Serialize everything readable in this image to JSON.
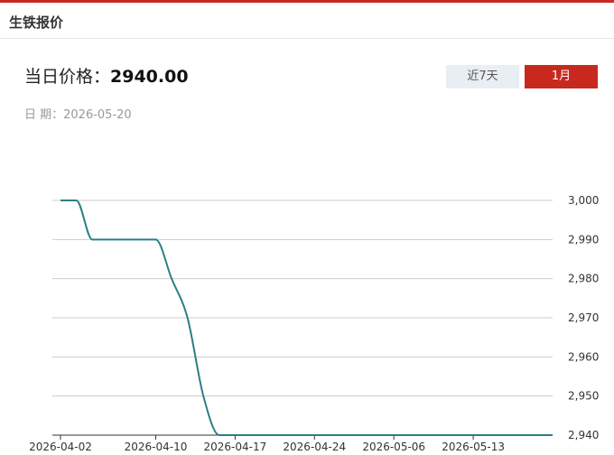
{
  "header": {
    "title": "生铁报价"
  },
  "summary": {
    "price_label": "当日价格：",
    "price_value": "2940.00",
    "date_label": "日 期：",
    "date_value": "2026-05-20"
  },
  "range_buttons": {
    "week_label": "近7天",
    "month_label": "1月",
    "active": "1月"
  },
  "colors": {
    "accent": "#c8281e",
    "line": "#2a7f86",
    "inactive_button": "#e9eef5"
  },
  "chart_data": {
    "type": "line",
    "x": [
      "2026-04-02",
      "2026-04-03",
      "2026-04-06",
      "2026-04-07",
      "2026-04-08",
      "2026-04-09",
      "2026-04-10",
      "2026-04-13",
      "2026-04-14",
      "2026-04-15",
      "2026-04-16",
      "2026-04-17",
      "2026-04-20",
      "2026-04-21",
      "2026-04-22",
      "2026-04-23",
      "2026-04-24",
      "2026-04-27",
      "2026-04-28",
      "2026-04-29",
      "2026-04-30",
      "2026-05-06",
      "2026-05-07",
      "2026-05-08",
      "2026-05-11",
      "2026-05-12",
      "2026-05-13",
      "2026-05-14",
      "2026-05-15",
      "2026-05-18",
      "2026-05-19",
      "2026-05-20"
    ],
    "series": [
      {
        "values": [
          3000,
          3000,
          2990,
          2990,
          2990,
          2990,
          2990,
          2980,
          2970,
          2950,
          2940,
          2940,
          2940,
          2940,
          2940,
          2940,
          2940,
          2940,
          2940,
          2940,
          2940,
          2940,
          2940,
          2940,
          2940,
          2940,
          2940,
          2940,
          2940,
          2940,
          2940,
          2940
        ]
      }
    ],
    "x_ticks": [
      "2026-04-02",
      "2026-04-10",
      "2026-04-17",
      "2026-04-24",
      "2026-05-06",
      "2026-05-13"
    ],
    "y_ticks": [
      "3,000",
      "2,990",
      "2,980",
      "2,970",
      "2,960",
      "2,950",
      "2,940"
    ],
    "ylim": [
      2940,
      3000
    ],
    "title": "",
    "xlabel": "",
    "ylabel": "",
    "grid": true,
    "y_axis_position": "right"
  }
}
